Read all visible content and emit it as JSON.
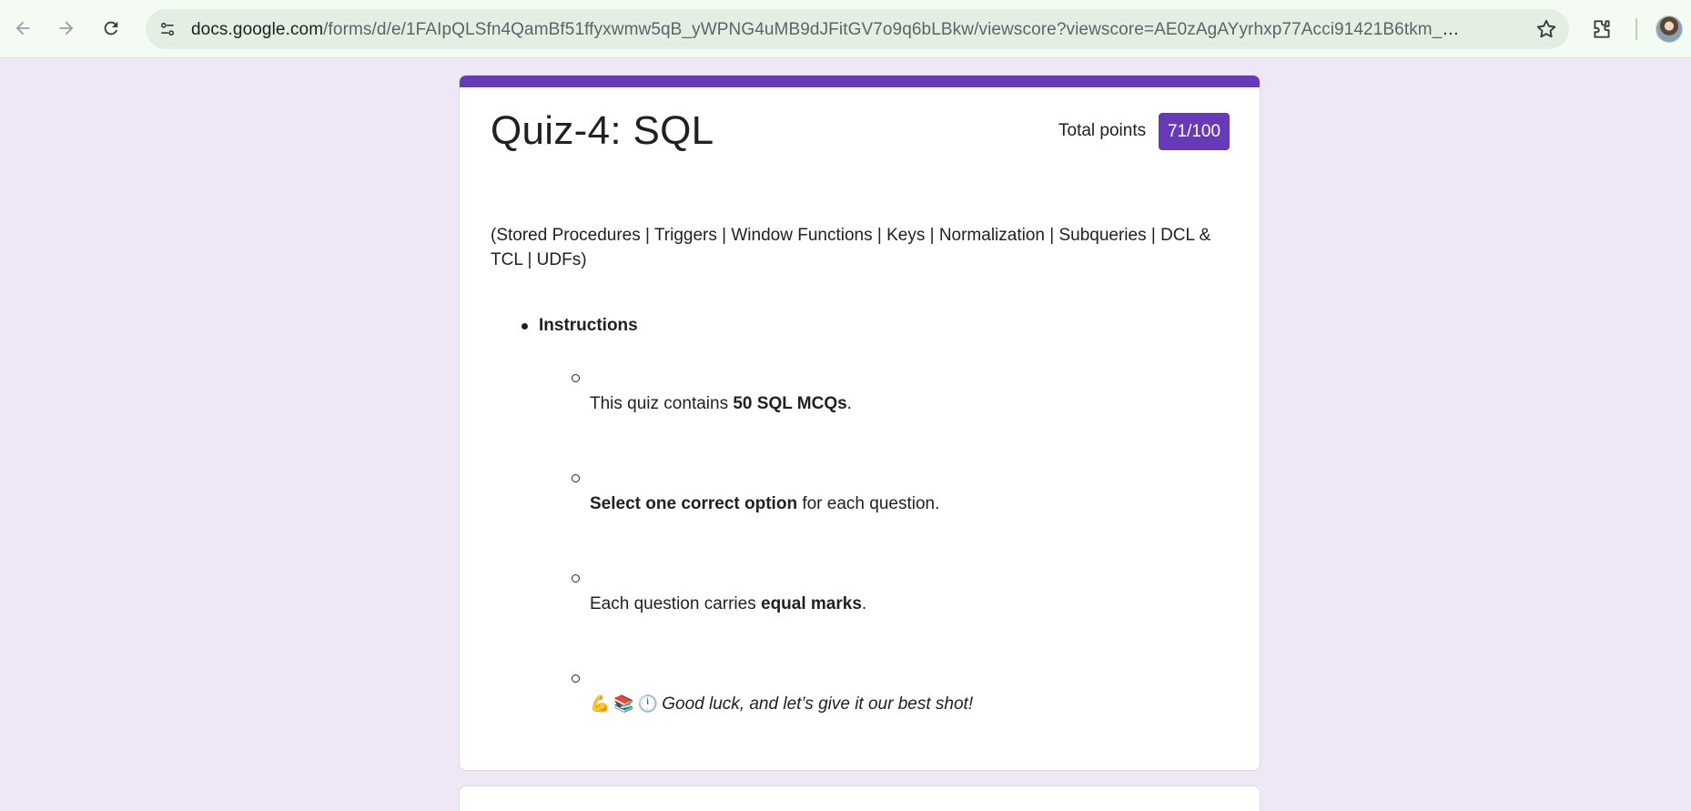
{
  "browser": {
    "url_host": "docs.google.com",
    "url_path": "/forms/d/e/1FAIpQLSfn4QamBf51ffyxwmw5qB_yWPNG4uMB9dJFitGV7o9q6bLBkw/viewscore?viewscore=AE0zAgAYyrhxp77Acci91421B6tkm_qYhY22KN..."
  },
  "form": {
    "title": "Quiz-4: SQL",
    "points_label": "Total points",
    "points_value": "71/100",
    "description": "(Stored Procedures | Triggers | Window Functions | Keys | Normalization | Subqueries | DCL & TCL | UDFs)",
    "instructions_heading": "Instructions",
    "items": [
      {
        "pre": "This quiz contains ",
        "bold": "50 SQL MCQs",
        "post": "."
      },
      {
        "bold": "Select one correct option",
        "post": " for each question."
      },
      {
        "pre": "Each question carries ",
        "bold": "equal marks",
        "post": "."
      },
      {
        "emoji": [
          "💪",
          "📚",
          "🕛"
        ],
        "italic": "Good luck, and let’s give it our best shot!"
      }
    ]
  },
  "colors": {
    "accent": "#673ab7",
    "background": "#ede7f6"
  }
}
